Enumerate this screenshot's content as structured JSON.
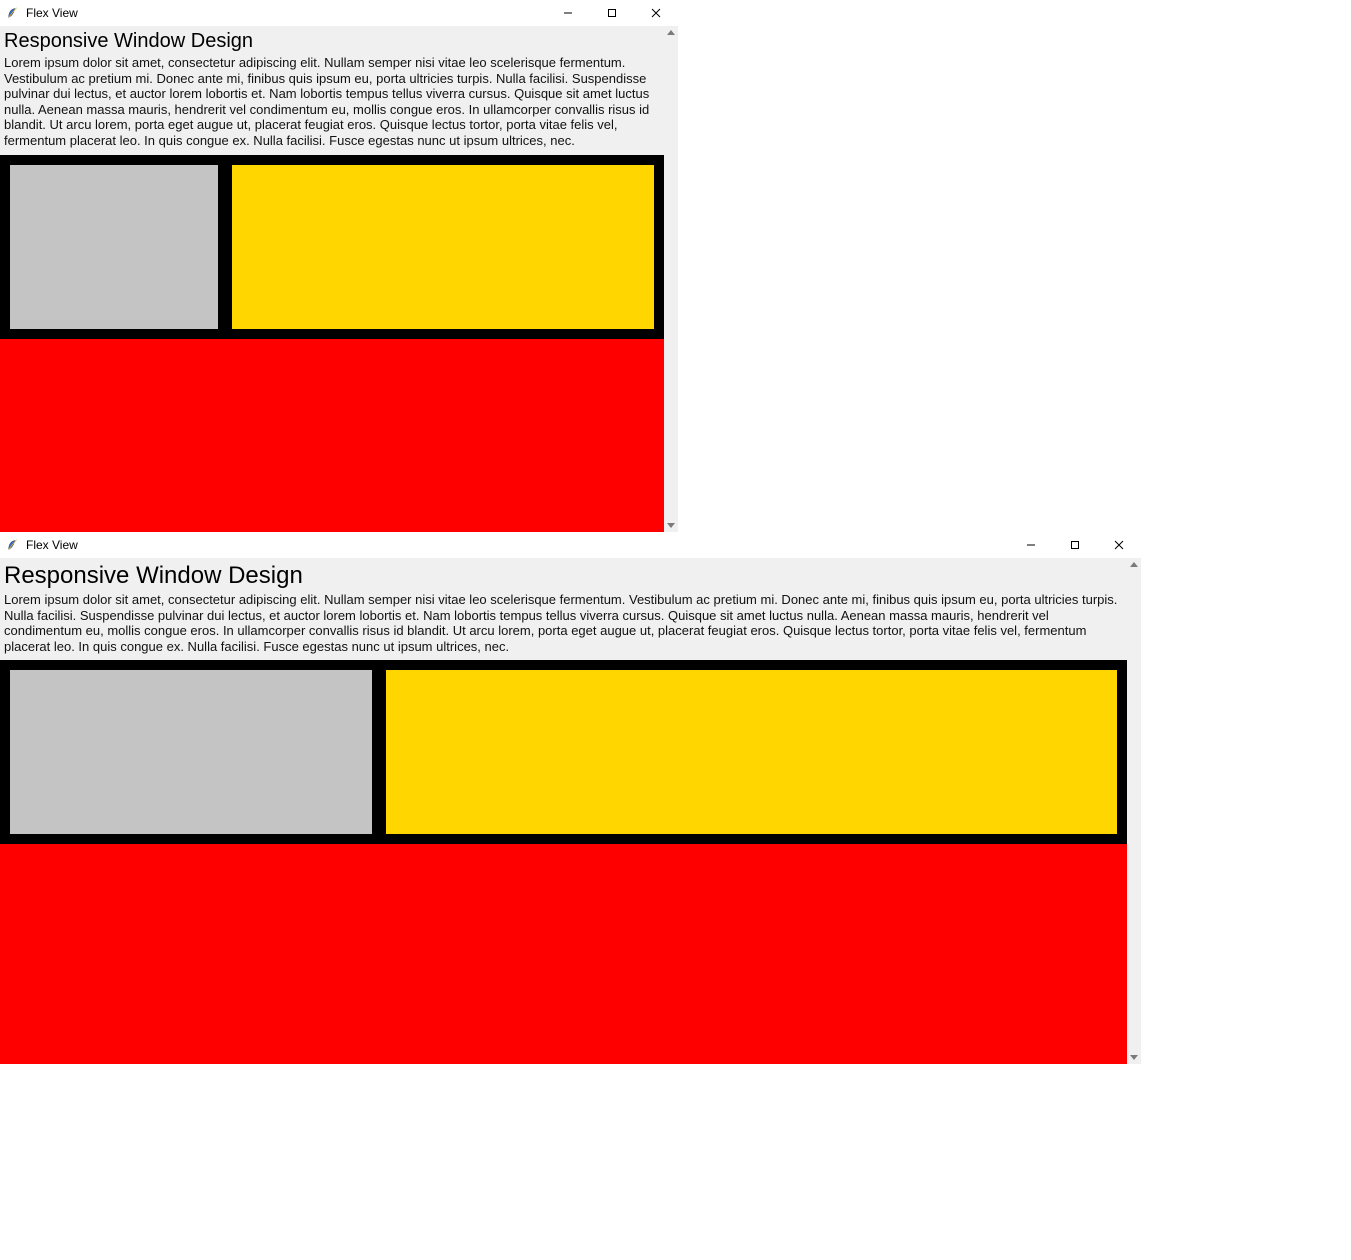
{
  "windows": [
    {
      "title": "Flex View",
      "heading": "Responsive Window Design",
      "body": "Lorem ipsum dolor sit amet, consectetur adipiscing elit. Nullam semper nisi vitae leo scelerisque fermentum. Vestibulum ac pretium mi. Donec ante mi, finibus quis ipsum eu, porta ultricies turpis. Nulla facilisi. Suspendisse pulvinar dui lectus, et auctor lorem lobortis et. Nam lobortis tempus tellus viverra cursus. Quisque sit amet luctus nulla. Aenean massa mauris, hendrerit vel condimentum eu, mollis congue eros. In ullamcorper convallis risus id blandit. Ut arcu lorem, porta eget augue ut, placerat feugiat eros. Quisque lectus tortor, porta vitae felis vel, fermentum placerat leo. In quis congue ex. Nulla facilisi. Fusce egestas nunc ut ipsum ultrices, nec."
    },
    {
      "title": "Flex View",
      "heading": "Responsive Window Design",
      "body": "Lorem ipsum dolor sit amet, consectetur adipiscing elit. Nullam semper nisi vitae leo scelerisque fermentum. Vestibulum ac pretium mi. Donec ante mi, finibus quis ipsum eu, porta ultricies turpis. Nulla facilisi. Suspendisse pulvinar dui lectus, et auctor lorem lobortis et. Nam lobortis tempus tellus viverra cursus. Quisque sit amet luctus nulla. Aenean massa mauris, hendrerit vel condimentum eu, mollis congue eros. In ullamcorper convallis risus id blandit. Ut arcu lorem, porta eget augue ut, placerat feugiat eros. Quisque lectus tortor, porta vitae felis vel, fermentum placerat leo. In quis congue ex. Nulla facilisi. Fusce egestas nunc ut ipsum ultrices, nec."
    }
  ],
  "colors": {
    "grey": "#c4c4c4",
    "yellow": "#ffd600",
    "red": "#ff0000",
    "black": "#000000",
    "page_bg": "#f0f0f0"
  }
}
